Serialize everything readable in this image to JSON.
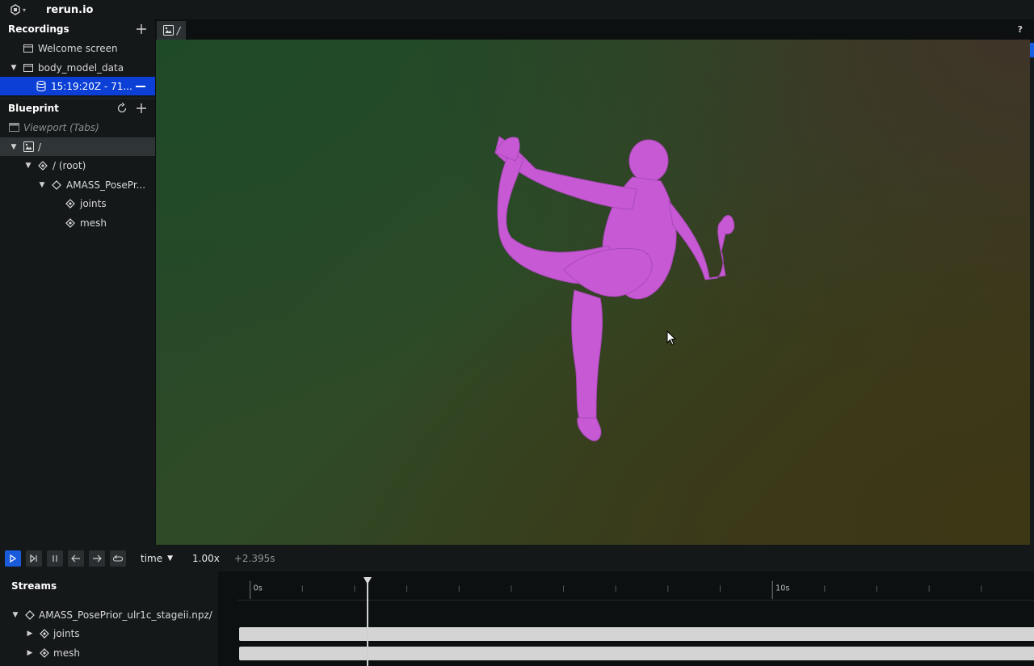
{
  "app": {
    "title": "rerun.io"
  },
  "recordings": {
    "header": "Recordings",
    "items": [
      {
        "label": "Welcome screen",
        "icon": "window-icon"
      },
      {
        "label": "body_model_data",
        "icon": "window-icon",
        "expanded": true
      },
      {
        "label": "15:19:20Z - 71...",
        "icon": "database-icon",
        "selected": true
      }
    ]
  },
  "blueprint": {
    "header": "Blueprint",
    "items": [
      {
        "label": "Viewport (Tabs)",
        "icon": "viewport-icon"
      },
      {
        "label": "/",
        "icon": "spatial-view-icon",
        "expanded": true
      },
      {
        "label": "/ (root)",
        "icon": "entity-group-icon",
        "expanded": true
      },
      {
        "label": "AMASS_PosePr...",
        "icon": "entity-icon",
        "expanded": true
      },
      {
        "label": "joints",
        "icon": "entity-icon"
      },
      {
        "label": "mesh",
        "icon": "entity-icon"
      }
    ]
  },
  "tabs": [
    {
      "label": "/",
      "icon": "spatial-view-icon"
    }
  ],
  "help_label": "?",
  "timeline": {
    "timeline_name": "time",
    "speed": "1.00x",
    "offset": "+2.395s",
    "tick_labels": [
      "0s",
      "10s"
    ],
    "playhead_seconds": 2.395
  },
  "streams": {
    "header": "Streams",
    "root": "AMASS_PosePrior_ulr1c_stageii.npz/",
    "children": [
      "joints",
      "mesh"
    ]
  },
  "colors": {
    "accent": "#1a5bdc",
    "selection": "#0b3fd6",
    "mesh": "#c75ad4"
  }
}
